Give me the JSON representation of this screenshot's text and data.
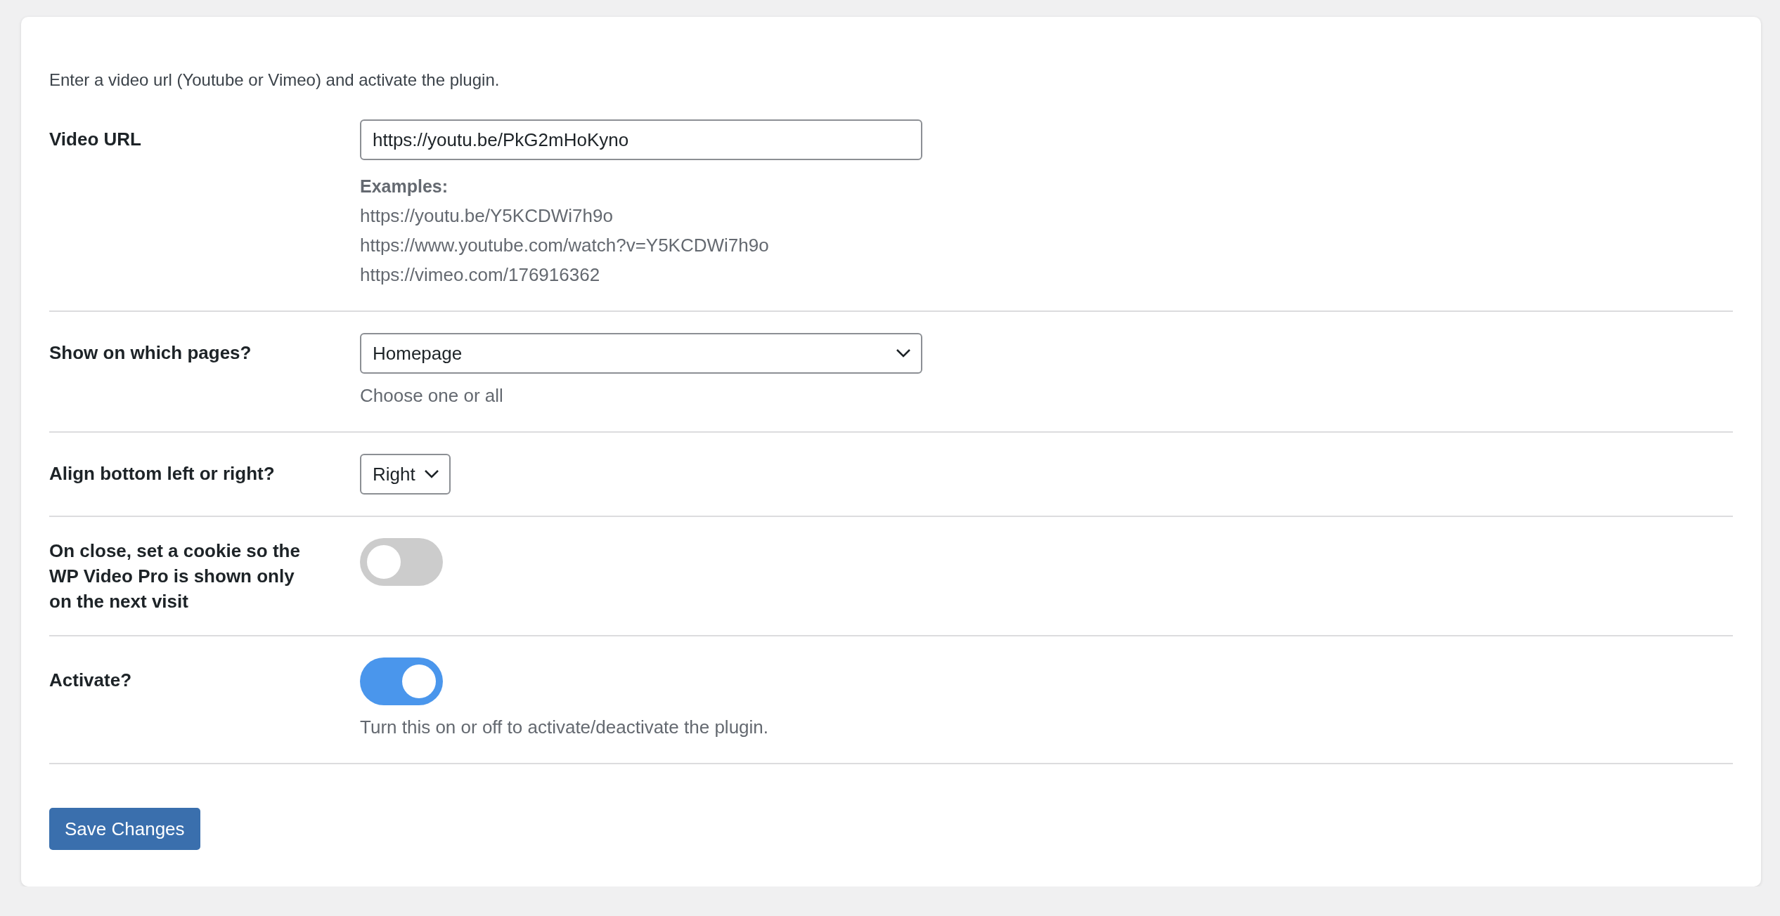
{
  "intro": "Enter a video url (Youtube or Vimeo) and activate the plugin.",
  "fields": [
    {
      "kind": "text",
      "label": "Video URL",
      "value": "https://youtu.be/PkG2mHoKyno",
      "help_title": "Examples:",
      "help_lines": [
        "https://youtu.be/Y5KCDWi7h9o",
        "https://www.youtube.com/watch?v=Y5KCDWi7h9o",
        "https://vimeo.com/176916362"
      ]
    },
    {
      "kind": "select",
      "label": "Show on which pages?",
      "value": "Homepage",
      "wide": true,
      "help_lines": [
        "Choose one or all"
      ]
    },
    {
      "kind": "select",
      "label": "Align bottom left or right?",
      "value": "Right",
      "wide": false
    },
    {
      "kind": "toggle",
      "label": "On close, set a cookie so the WP Video Pro is shown only on the next visit",
      "on": false
    },
    {
      "kind": "toggle",
      "label": "Activate?",
      "on": true,
      "help_lines": [
        "Turn this on or off to activate/deactivate the plugin."
      ]
    }
  ],
  "save_button": "Save Changes"
}
